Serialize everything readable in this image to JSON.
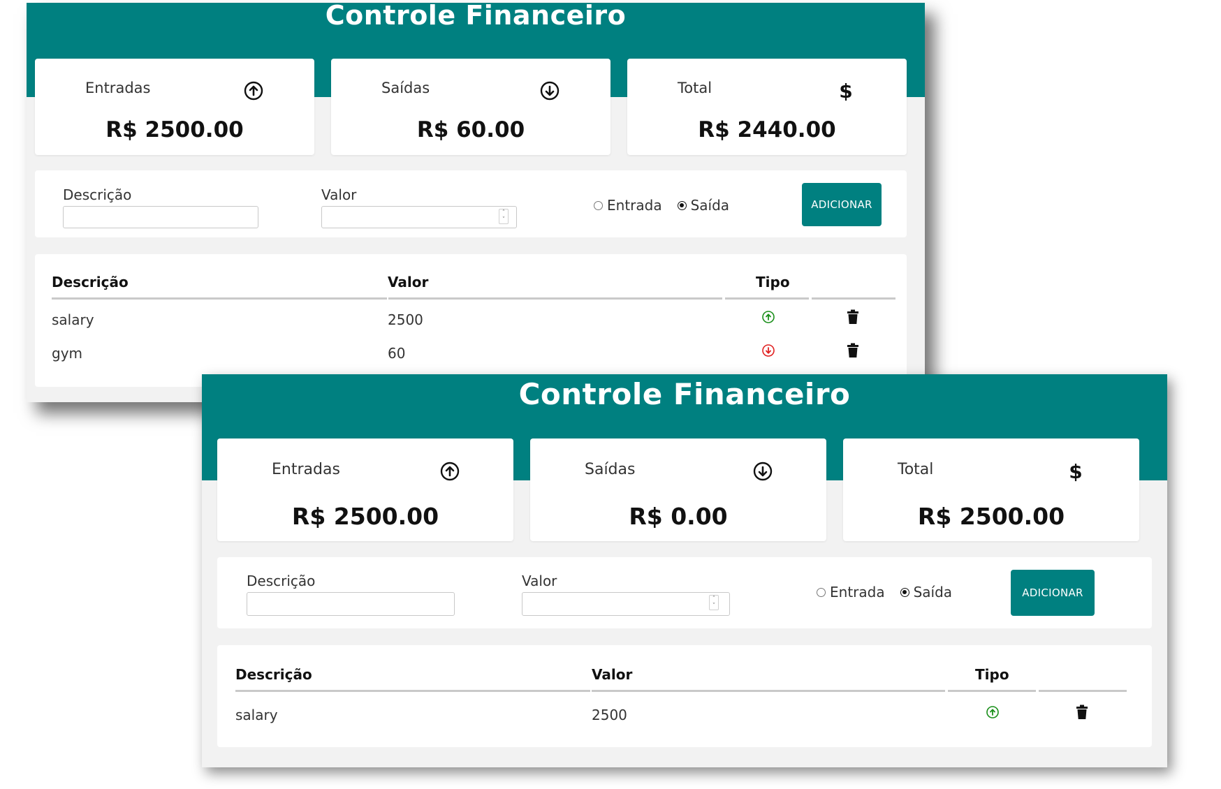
{
  "screens": [
    {
      "title": "Controle Financeiro",
      "cards": [
        {
          "label": "Entradas",
          "icon": "arrow-up-circle-icon",
          "value": "R$ 2500.00"
        },
        {
          "label": "Saídas",
          "icon": "arrow-down-circle-icon",
          "value": "R$ 60.00"
        },
        {
          "label": "Total",
          "icon": "dollar-icon",
          "value": "R$ 2440.00"
        }
      ],
      "form": {
        "desc_label": "Descrição",
        "desc_value": "",
        "valor_label": "Valor",
        "valor_value": "",
        "radio_entrada": "Entrada",
        "radio_saida": "Saída",
        "selected": "Saída",
        "button_label": "ADICIONAR"
      },
      "table": {
        "headers": [
          "Descrição",
          "Valor",
          "Tipo"
        ],
        "rows": [
          {
            "descricao": "salary",
            "valor": "2500",
            "tipo": "entrada"
          },
          {
            "descricao": "gym",
            "valor": "60",
            "tipo": "saida"
          }
        ]
      }
    },
    {
      "title": "Controle Financeiro",
      "cards": [
        {
          "label": "Entradas",
          "icon": "arrow-up-circle-icon",
          "value": "R$ 2500.00"
        },
        {
          "label": "Saídas",
          "icon": "arrow-down-circle-icon",
          "value": "R$ 0.00"
        },
        {
          "label": "Total",
          "icon": "dollar-icon",
          "value": "R$ 2500.00"
        }
      ],
      "form": {
        "desc_label": "Descrição",
        "desc_value": "",
        "valor_label": "Valor",
        "valor_value": "",
        "radio_entrada": "Entrada",
        "radio_saida": "Saída",
        "selected": "Saída",
        "button_label": "ADICIONAR"
      },
      "table": {
        "headers": [
          "Descrição",
          "Valor",
          "Tipo"
        ],
        "rows": [
          {
            "descricao": "salary",
            "valor": "2500",
            "tipo": "entrada"
          }
        ]
      }
    }
  ],
  "colors": {
    "header_teal": "#008080",
    "entrada_green": "#1a8f1a",
    "saida_red": "#e02020",
    "panel_bg": "#f2f2f2"
  }
}
